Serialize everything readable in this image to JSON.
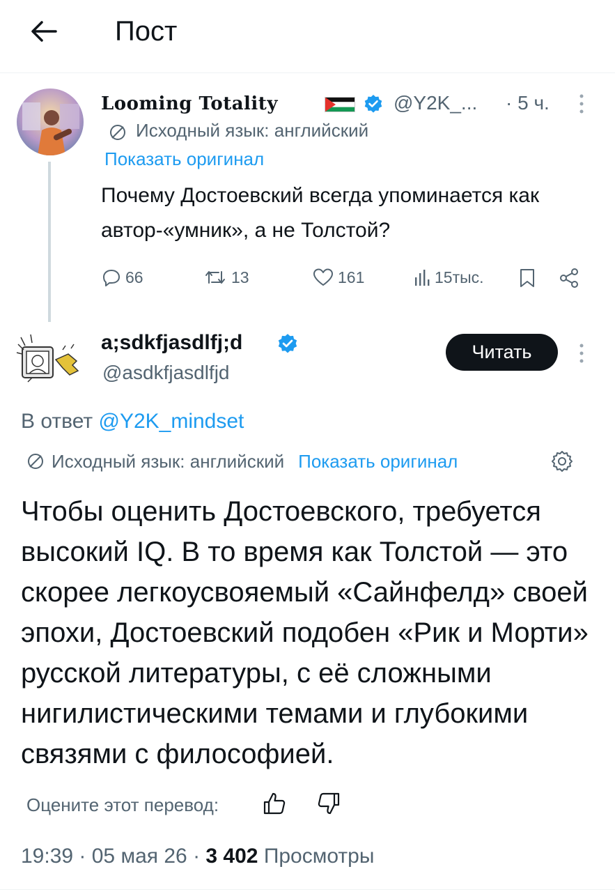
{
  "header": {
    "title": "Пост"
  },
  "original_tweet": {
    "display_name": "Looming Totality",
    "handle": "@Y2K_...",
    "time": "· 5 ч.",
    "translation_label": "Исходный язык: английский",
    "show_original": "Показать оригинал",
    "text": "Почему Достоевский всегда упоминается как автор-«умник», а не Толстой?",
    "actions": {
      "replies": "66",
      "retweets": "13",
      "likes": "161",
      "views": "15тыс."
    }
  },
  "reply_tweet": {
    "display_name": "a;sdkfjasdlfj;d",
    "handle": "@asdkfjasdlfjd",
    "follow_label": "Читать",
    "reply_prefix": "В ответ",
    "reply_handle": "@Y2K_mindset",
    "translation_label": "Исходный язык: английский",
    "show_original": "Показать оригинал",
    "text": "Чтобы оценить Достоевского, требуется высокий IQ. В то время как Толстой — это скорее легкоусвояемый «Сайнфелд» своей эпохи, Достоевский подобен «Рик и Морти» русской литературы, с её сложными нигилистическими темами и глубокими связями с философией.",
    "rate_label": "Оцените этот перевод:",
    "meta": {
      "time": "19:39",
      "date": "05 мая 26",
      "views_count": "3 402",
      "views_label": "Просмотры"
    }
  },
  "colors": {
    "accent": "#1d9bf0",
    "text": "#0f1419",
    "muted": "#536471",
    "verified": "#1d9bf0",
    "follow_bg": "#0f1419"
  }
}
